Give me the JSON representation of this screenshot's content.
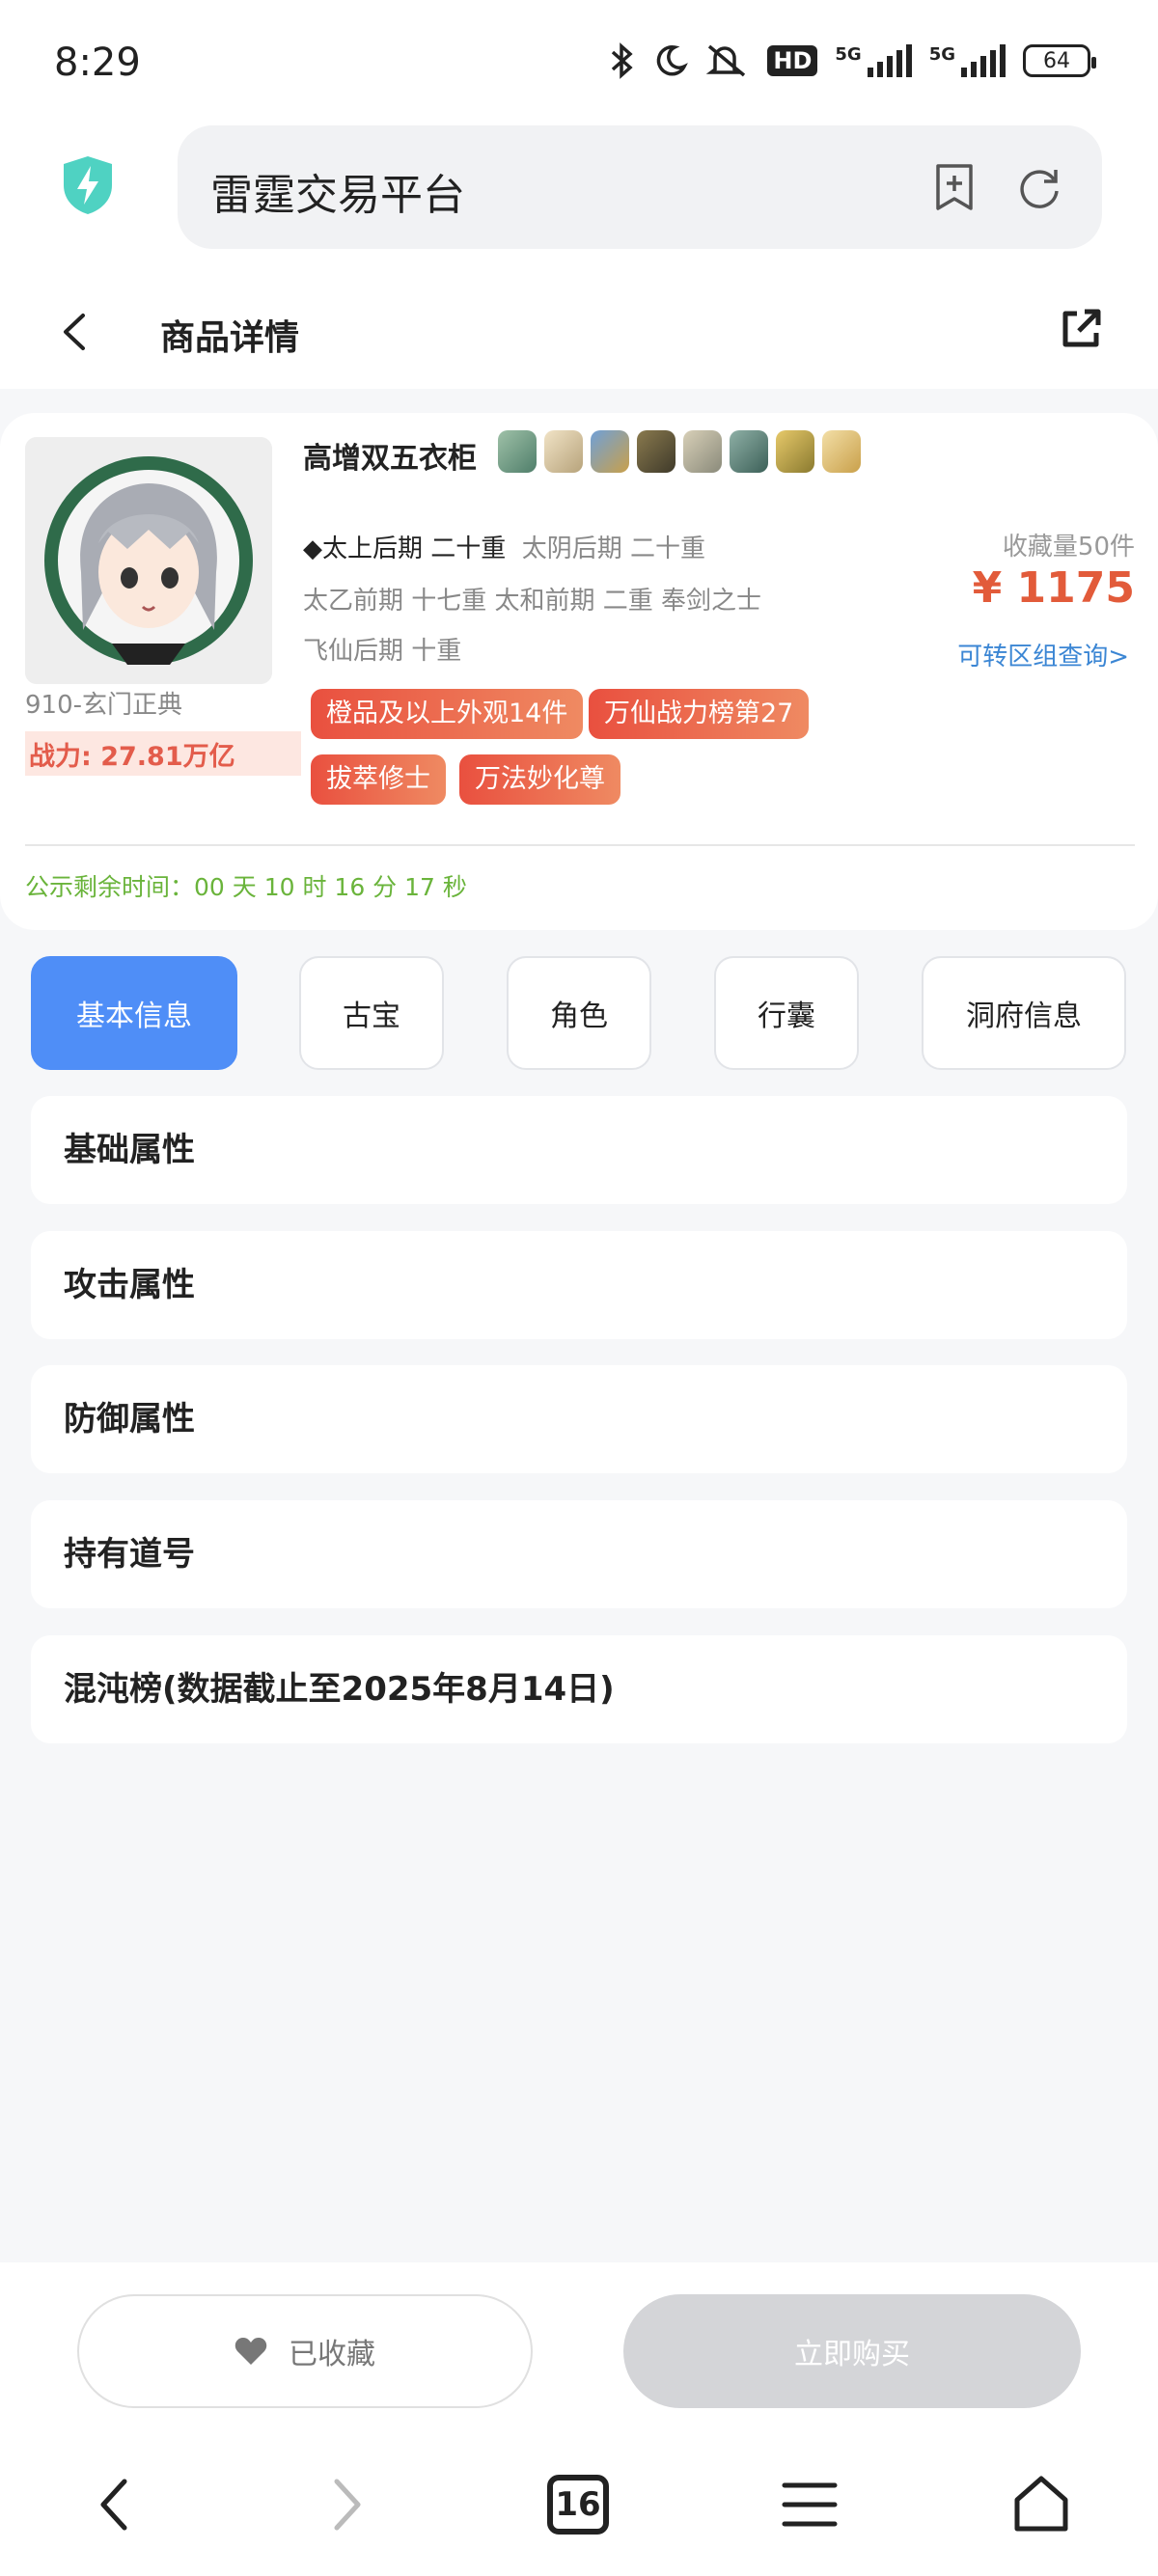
{
  "status_bar": {
    "time": "8:29",
    "network1": "5G",
    "network2": "5G",
    "hd_label": "HD",
    "battery": "64"
  },
  "browser": {
    "title": "雷霆交易平台"
  },
  "header": {
    "title": "商品详情"
  },
  "product": {
    "server": "910-玄门正典",
    "power_label": "战力: 27.81万亿",
    "title": "高增双五衣柜",
    "attr_line1_bold": "◆太上后期 二十重",
    "attr_line1_rest": "太阴后期 二十重",
    "attr_line2": "太乙前期 十七重  太和前期 二重  奉剑之士",
    "attr_line3": "飞仙后期 十重",
    "fav_count": "收藏量50件",
    "price": "¥ 1175",
    "transfer_link": "可转区组查询>",
    "tags": [
      "橙品及以上外观14件",
      "万仙战力榜第27",
      "拔萃修士",
      "万法妙化尊"
    ],
    "countdown": "公示剩余时间：00 天 10 时 16 分 17 秒"
  },
  "tabs": [
    "基本信息",
    "古宝",
    "角色",
    "行囊",
    "洞府信息"
  ],
  "sections": [
    "基础属性",
    "攻击属性",
    "防御属性",
    "持有道号",
    "混沌榜(数据截止至2025年8月14日)"
  ],
  "actions": {
    "collect": "已收藏",
    "buy": "立即购买"
  },
  "browser_nav": {
    "tab_count": "16"
  },
  "colors": {
    "accent": "#4f8ef7",
    "price": "#e25b3a",
    "countdown": "#6ab43b",
    "link": "#3b86d4"
  }
}
